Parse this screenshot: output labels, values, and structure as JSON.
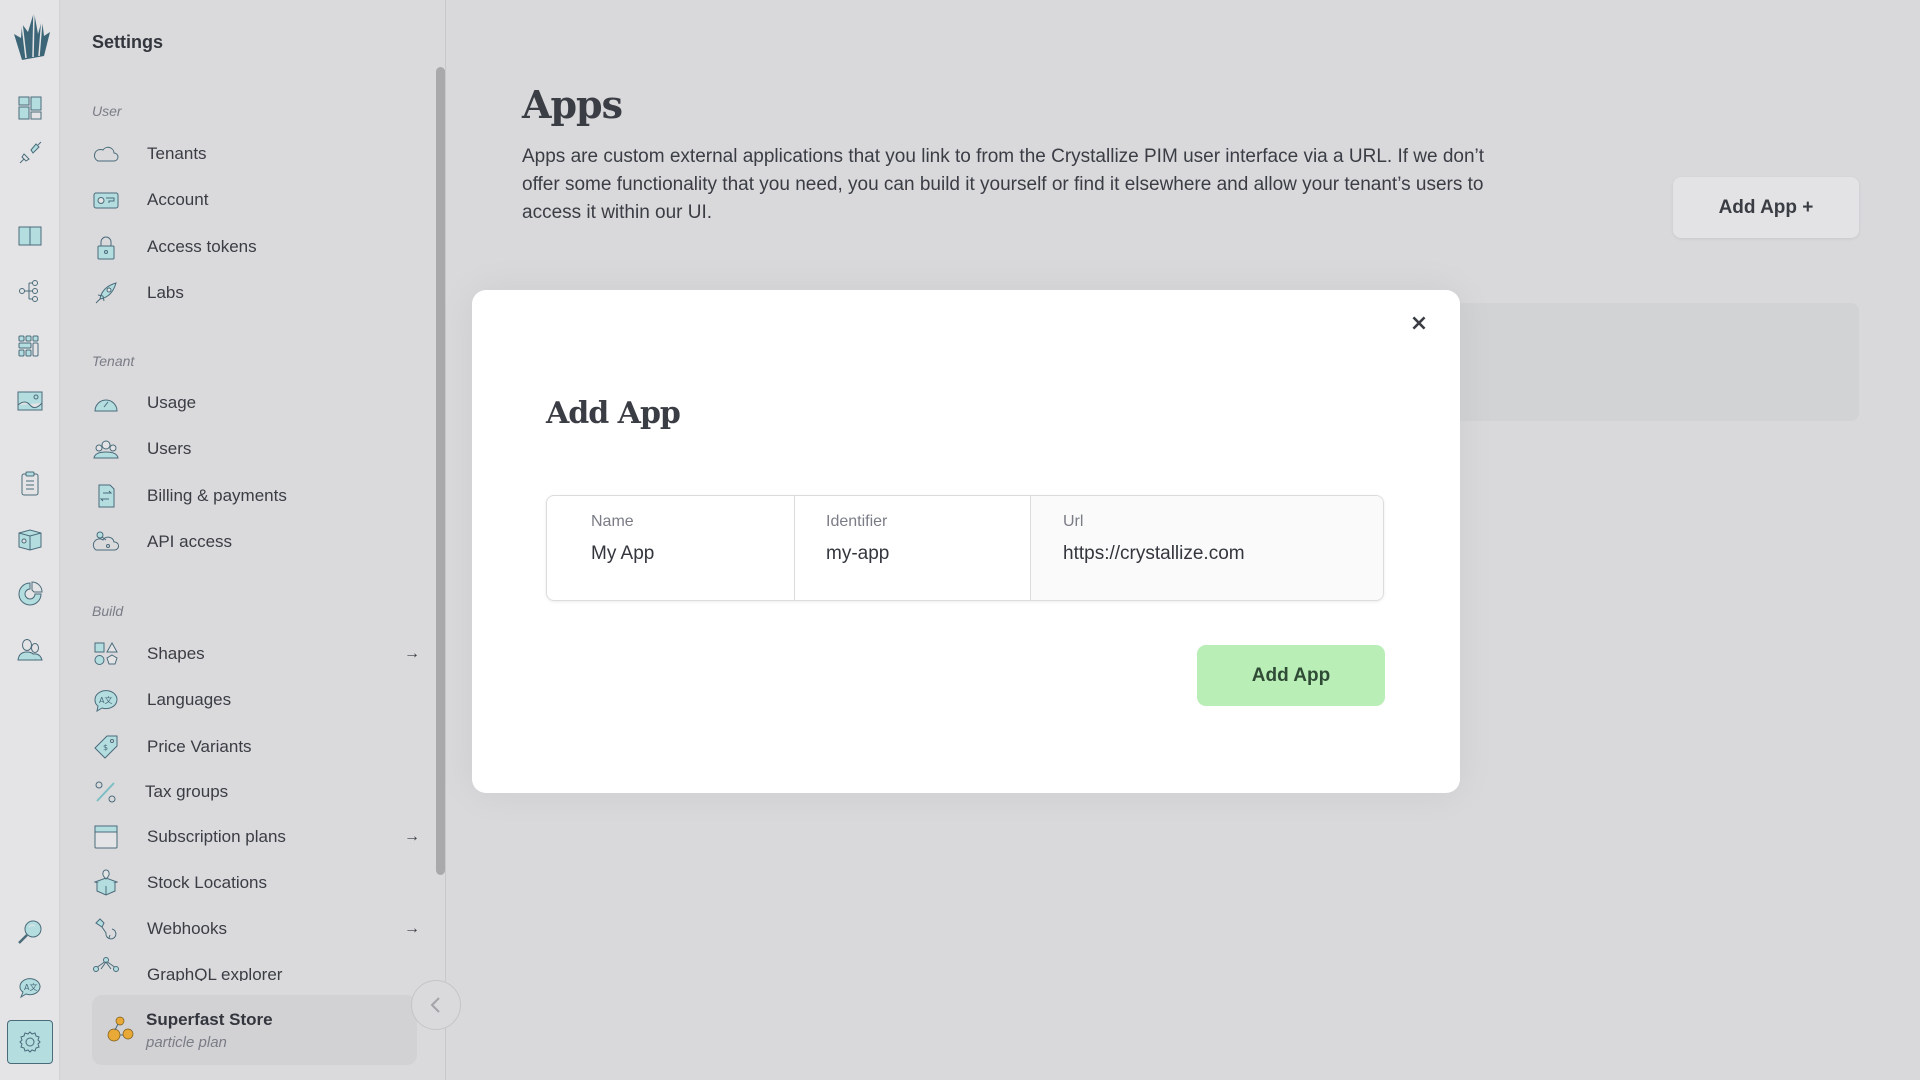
{
  "rail": {
    "logo": "crystallize-logo",
    "items": [
      {
        "icon": "dashboard-icon"
      },
      {
        "icon": "plug-icon"
      },
      {
        "icon": "catalogue-book-icon"
      },
      {
        "icon": "topics-tree-icon"
      },
      {
        "icon": "grid-icon"
      },
      {
        "icon": "image-icon"
      },
      {
        "icon": "clipboard-icon"
      },
      {
        "icon": "box-icon"
      },
      {
        "icon": "pie-chart-icon"
      },
      {
        "icon": "customers-icon"
      }
    ],
    "bottom": [
      {
        "icon": "search-icon"
      },
      {
        "icon": "translate-icon"
      },
      {
        "icon": "settings-gear-icon",
        "active": true
      }
    ]
  },
  "sidebar": {
    "title": "Settings",
    "sections": [
      {
        "label": "User",
        "items": [
          {
            "label": "Tenants",
            "icon": "cloud-icon"
          },
          {
            "label": "Account",
            "icon": "id-card-icon"
          },
          {
            "label": "Access tokens",
            "icon": "lock-icon"
          },
          {
            "label": "Labs",
            "icon": "rocket-icon"
          }
        ]
      },
      {
        "label": "Tenant",
        "items": [
          {
            "label": "Usage",
            "icon": "gauge-icon"
          },
          {
            "label": "Users",
            "icon": "users-icon"
          },
          {
            "label": "Billing & payments",
            "icon": "billing-icon"
          },
          {
            "label": "API access",
            "icon": "cloud-key-icon"
          }
        ]
      },
      {
        "label": "Build",
        "items": [
          {
            "label": "Shapes",
            "icon": "shapes-icon",
            "arrow": "→"
          },
          {
            "label": "Languages",
            "icon": "languages-icon"
          },
          {
            "label": "Price Variants",
            "icon": "price-tag-icon"
          },
          {
            "label": "Tax groups",
            "icon": "percent-icon"
          },
          {
            "label": "Subscription plans",
            "icon": "calendar-icon",
            "arrow": "→"
          },
          {
            "label": "Stock Locations",
            "icon": "stock-box-icon"
          },
          {
            "label": "Webhooks",
            "icon": "webhook-icon",
            "arrow": "→"
          },
          {
            "label": "GraphQL explorer",
            "icon": "graphql-icon"
          }
        ]
      }
    ],
    "tenant": {
      "name": "Superfast Store",
      "plan": "particle plan"
    }
  },
  "main": {
    "title": "Apps",
    "description": "Apps are custom external applications that you link to from the Crystallize PIM user interface via a URL. If we don’t offer some functionality that you need, you can build it yourself or find it elsewhere and allow your tenant’s users to access it within our UI.",
    "add_button": "Add App +"
  },
  "modal": {
    "title": "Add App",
    "close": "×",
    "fields": [
      {
        "label": "Name",
        "value": "My App"
      },
      {
        "label": "Identifier",
        "value": "my-app"
      },
      {
        "label": "Url",
        "value": "https://crystallize.com"
      }
    ],
    "submit": "Add App"
  },
  "colors": {
    "accent": "#b4dde0",
    "icon_stroke": "#4a6b7a",
    "submit_bg": "#b9efb7",
    "tenant_icon": "#e8a937"
  }
}
